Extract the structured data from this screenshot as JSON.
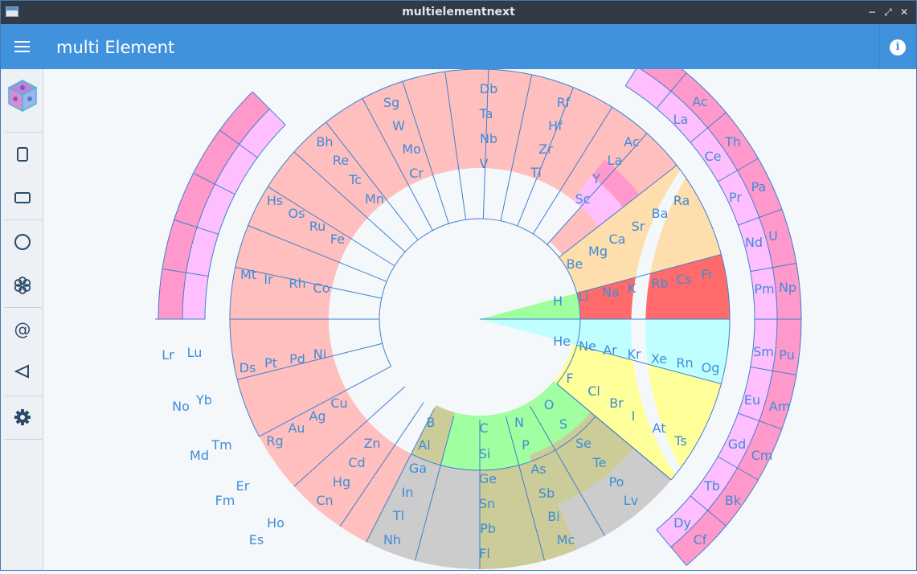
{
  "window": {
    "title": "multielementnext",
    "buttons": {
      "minimize": "−",
      "maximize": "⤢",
      "close": "✕"
    }
  },
  "appbar": {
    "title": "multi Element",
    "info_label": "i"
  },
  "sidebar": {
    "items": [
      {
        "name": "app-logo-cube-icon"
      },
      {
        "name": "portrait-rect-icon"
      },
      {
        "name": "landscape-rect-icon"
      },
      {
        "name": "circle-icon"
      },
      {
        "name": "flower-icon"
      },
      {
        "name": "at-sign-icon"
      },
      {
        "name": "back-triangle-icon"
      },
      {
        "name": "gear-icon"
      }
    ]
  },
  "colors": {
    "transition": "#ffbfbf",
    "alkaline": "#ffdead",
    "alkali": "#ff6b6b",
    "hydrogen": "#9eff9e",
    "noble": "#c0ffff",
    "halogen": "#ffff99",
    "metalloid": "#cccc99",
    "post_transition": "#cccccc",
    "nonmetal": "#a0ffa0",
    "lanthanide": "#ffbfff",
    "actinide": "#ff99cc",
    "line": "#3d7fd0",
    "text": "#3d8dd8",
    "canvas": "#f5f8fb"
  },
  "chart_data": {
    "type": "circular periodic table",
    "elements": [
      "H",
      "He",
      "Li",
      "Be",
      "B",
      "C",
      "N",
      "O",
      "F",
      "Ne",
      "Na",
      "Mg",
      "Al",
      "Si",
      "P",
      "S",
      "Cl",
      "Ar",
      "K",
      "Ca",
      "Sc",
      "Ti",
      "V",
      "Cr",
      "Mn",
      "Fe",
      "Co",
      "Ni",
      "Cu",
      "Zn",
      "Ga",
      "Ge",
      "As",
      "Se",
      "Br",
      "Kr",
      "Rb",
      "Sr",
      "Y",
      "Zr",
      "Nb",
      "Mo",
      "Tc",
      "Ru",
      "Rh",
      "Pd",
      "Ag",
      "Cd",
      "In",
      "Sn",
      "Sb",
      "Te",
      "I",
      "Xe",
      "Cs",
      "Ba",
      "La",
      "Hf",
      "Ta",
      "W",
      "Re",
      "Os",
      "Ir",
      "Pt",
      "Au",
      "Hg",
      "Tl",
      "Pb",
      "Bi",
      "Po",
      "At",
      "Rn",
      "Fr",
      "Ra",
      "Ac",
      "Rf",
      "Db",
      "Sg",
      "Bh",
      "Hs",
      "Mt",
      "Ds",
      "Rg",
      "Cn",
      "Nh",
      "Fl",
      "Mc",
      "Lv",
      "Ts",
      "Og",
      "Ce",
      "Pr",
      "Nd",
      "Pm",
      "Sm",
      "Eu",
      "Gd",
      "Tb",
      "Dy",
      "Th",
      "Pa",
      "U",
      "Np",
      "Pu",
      "Am",
      "Cm",
      "Bk",
      "Cf",
      "Lu",
      "Yb",
      "Tm",
      "Er",
      "Ho",
      "Lr",
      "No",
      "Md",
      "Fm",
      "Es"
    ]
  }
}
